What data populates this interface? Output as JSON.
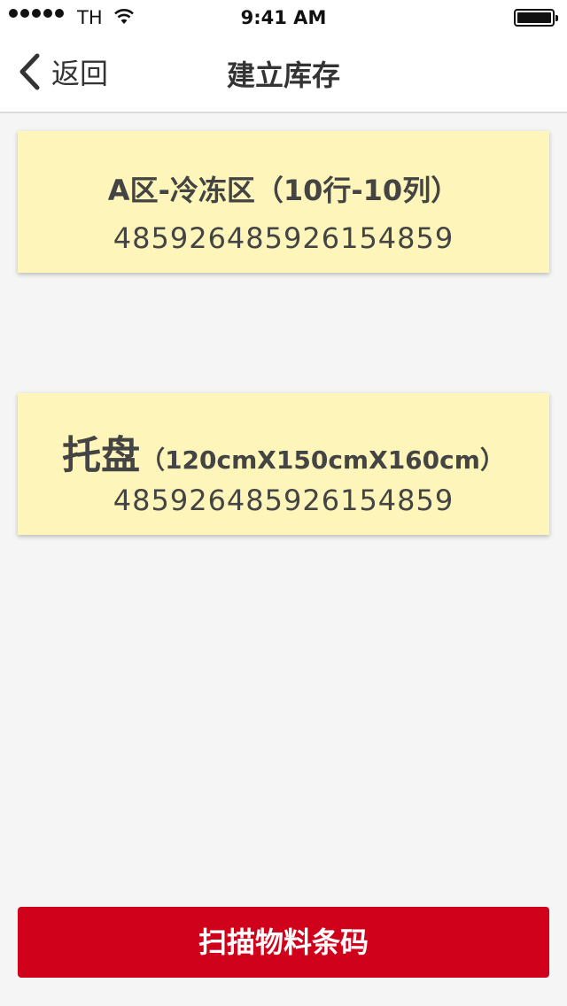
{
  "status_bar": {
    "carrier": "TH",
    "time": "9:41 AM",
    "battery_level": 1.0
  },
  "nav": {
    "back_label": "返回",
    "title": "建立库存"
  },
  "location_card": {
    "title": "A区-冷冻区（10行-10列）",
    "code": "485926485926154859"
  },
  "pallet_card": {
    "name": "托盘",
    "dimensions": "（120cmX150cmX160cm）",
    "code": "485926485926154859"
  },
  "scan_button": {
    "label": "扫描物料条码"
  },
  "colors": {
    "accent": "#d0021b",
    "card_background": "#fdf5b9",
    "page_background": "#f5f5f5"
  }
}
